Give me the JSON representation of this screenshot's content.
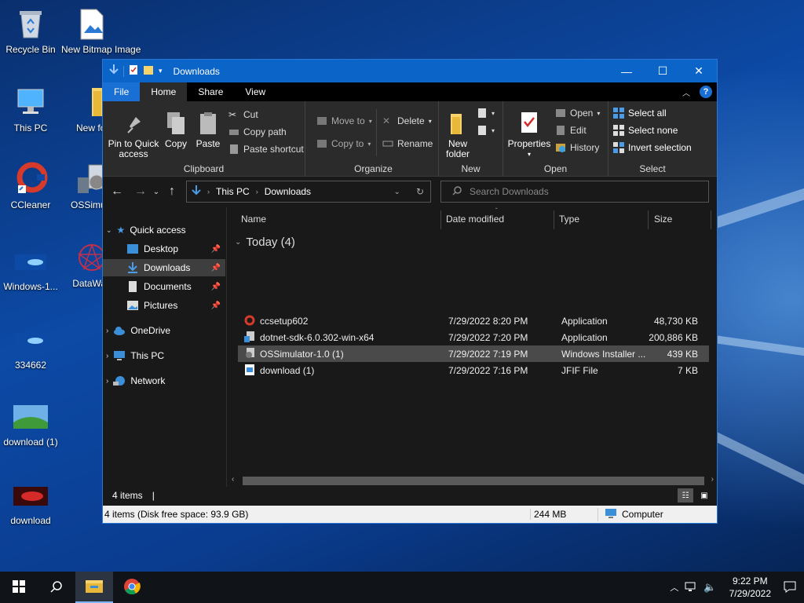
{
  "desktop": {
    "icons": [
      {
        "label": "Recycle Bin"
      },
      {
        "label": "New Bitmap Image"
      },
      {
        "label": "This PC"
      },
      {
        "label": "New fol"
      },
      {
        "label": "CCleaner"
      },
      {
        "label": "OSSimula"
      },
      {
        "label": "Windows-1..."
      },
      {
        "label": "DataWag"
      },
      {
        "label": "334662"
      },
      {
        "label": "download (1)"
      },
      {
        "label": "download"
      }
    ]
  },
  "window": {
    "title": "Downloads",
    "controls": {
      "minimize": "—",
      "maximize": "☐",
      "close": "✕"
    }
  },
  "ribbon_tabs": [
    "File",
    "Home",
    "Share",
    "View"
  ],
  "ribbon": {
    "clipboard": {
      "name": "Clipboard",
      "pin": "Pin to Quick access",
      "copy": "Copy",
      "paste": "Paste",
      "cut": "Cut",
      "copy_path": "Copy path",
      "paste_shortcut": "Paste shortcut"
    },
    "organize": {
      "name": "Organize",
      "move_to": "Move to",
      "copy_to": "Copy to",
      "delete": "Delete",
      "rename": "Rename"
    },
    "new": {
      "name": "New",
      "new_folder": "New folder"
    },
    "open": {
      "name": "Open",
      "properties": "Properties",
      "open": "Open",
      "edit": "Edit",
      "history": "History"
    },
    "select": {
      "name": "Select",
      "select_all": "Select all",
      "select_none": "Select none",
      "invert": "Invert selection"
    }
  },
  "address": {
    "crumbs": [
      "This PC",
      "Downloads"
    ],
    "search_placeholder": "Search Downloads"
  },
  "nav": {
    "quick_access": "Quick access",
    "quick_items": [
      "Desktop",
      "Downloads",
      "Documents",
      "Pictures"
    ],
    "onedrive": "OneDrive",
    "this_pc": "This PC",
    "network": "Network"
  },
  "columns": [
    "Name",
    "Date modified",
    "Type",
    "Size"
  ],
  "group_label": "Today (4)",
  "files": [
    {
      "name": "ccsetup602",
      "date": "7/29/2022 8:20 PM",
      "type": "Application",
      "size": "48,730 KB"
    },
    {
      "name": "dotnet-sdk-6.0.302-win-x64",
      "date": "7/29/2022 7:20 PM",
      "type": "Application",
      "size": "200,886 KB"
    },
    {
      "name": "OSSimulator-1.0 (1)",
      "date": "7/29/2022 7:19 PM",
      "type": "Windows Installer ...",
      "size": "439 KB"
    },
    {
      "name": "download (1)",
      "date": "7/29/2022 7:16 PM",
      "type": "JFIF File",
      "size": "7 KB"
    }
  ],
  "status": {
    "items": "4 items",
    "separator": "|"
  },
  "bottom": {
    "summary": "4 items (Disk free space: 93.9 GB)",
    "size": "244 MB",
    "location": "Computer"
  },
  "taskbar": {
    "time": "9:22 PM",
    "date": "7/29/2022"
  }
}
